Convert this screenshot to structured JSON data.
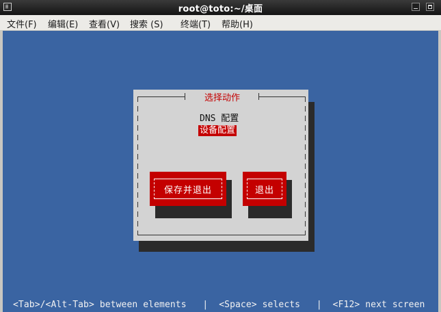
{
  "window": {
    "title": "root@toto:~/桌面"
  },
  "menu": {
    "items": [
      "文件(F)",
      "编辑(E)",
      "查看(V)",
      "搜索 (S)",
      "终端(T)",
      "帮助(H)"
    ]
  },
  "dialog": {
    "title": "选择动作",
    "options": [
      "DNS 配置",
      "设备配置"
    ],
    "selected_option": "设备配置",
    "buttons": {
      "save_quit": "保存并退出",
      "quit": "退出"
    }
  },
  "status_line": "<Tab>/<Alt-Tab> between elements   |  <Space> selects   |  <F12> next screen",
  "colors": {
    "background": "#3a64a2",
    "dialog": "#d3d3d3",
    "accent_red": "#c40000",
    "shadow": "#2b2b2b"
  }
}
